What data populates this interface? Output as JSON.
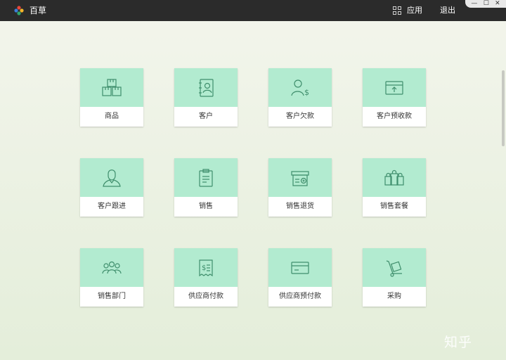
{
  "titlebar": {
    "app_title": "百草",
    "apps_label": "应用",
    "logout_label": "退出",
    "window_controls": {
      "minimize": "—",
      "maximize": "☐",
      "close": "✕"
    }
  },
  "colors": {
    "titlebar_bg": "#2b2b2b",
    "tile_accent": "#b2ebd0",
    "icon_stroke": "#3f8e6c"
  },
  "tiles": [
    {
      "label": "商品",
      "icon": "boxes-icon"
    },
    {
      "label": "客户",
      "icon": "contact-book-icon"
    },
    {
      "label": "客户欠款",
      "icon": "customer-money-icon"
    },
    {
      "label": "客户预收款",
      "icon": "prepay-card-icon"
    },
    {
      "label": "客户跟进",
      "icon": "person-bust-icon"
    },
    {
      "label": "销售",
      "icon": "clipboard-icon"
    },
    {
      "label": "销售退货",
      "icon": "return-box-icon"
    },
    {
      "label": "销售套餐",
      "icon": "shopping-bags-icon"
    },
    {
      "label": "销售部门",
      "icon": "team-icon"
    },
    {
      "label": "供应商付款",
      "icon": "receipt-icon"
    },
    {
      "label": "供应商预付款",
      "icon": "credit-card-icon"
    },
    {
      "label": "采购",
      "icon": "hand-truck-icon"
    }
  ],
  "watermark": "知乎"
}
